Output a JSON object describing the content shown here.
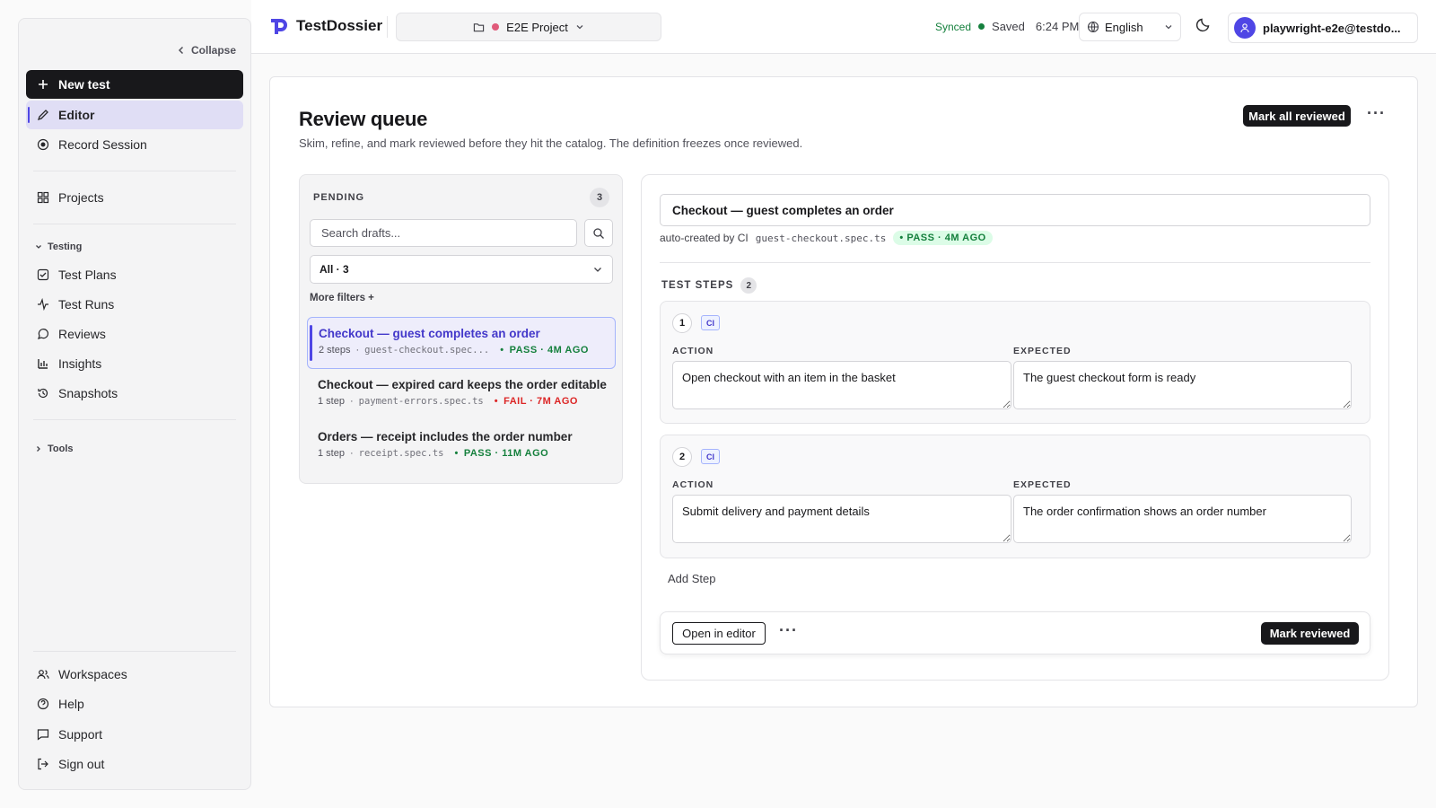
{
  "sidebar": {
    "collapse_label": "Collapse",
    "new_test": "New test",
    "items_top": [
      "Editor",
      "Record Session"
    ],
    "projects": "Projects",
    "testing_section": "Testing",
    "testing_items": [
      "Test Plans",
      "Test Runs",
      "Reviews",
      "Insights",
      "Snapshots"
    ],
    "tools_section": "Tools",
    "bottom_items": [
      "Workspaces",
      "Help",
      "Support",
      "Sign out"
    ]
  },
  "topbar": {
    "app_name": "TestDossier",
    "project_name": "E2E Project",
    "project_color": "#e05a7a",
    "sync_status": "Synced",
    "sync_color": "#15803d",
    "save_status": "Saved",
    "save_time": "6:24 PM",
    "language": "English",
    "user_email": "playwright-e2e@testdo..."
  },
  "page": {
    "title": "Review queue",
    "subtitle": "Skim, refine, and mark reviewed before they hit the catalog. The definition freezes once reviewed.",
    "mark_all_label": "Mark all reviewed",
    "more_icon": "ellipsis-icon"
  },
  "pending": {
    "title": "PENDING",
    "count": "3",
    "search_placeholder": "Search drafts...",
    "filter_value": "All · 3",
    "more_filters": "More filters +",
    "drafts": [
      {
        "title": "Checkout — guest completes an order",
        "steps": "2 steps",
        "file": "guest-checkout.spec...",
        "status": "PASS · 4M AGO",
        "result": "pass"
      },
      {
        "title": "Checkout — expired card keeps the order editable",
        "steps": "1 step",
        "file": "payment-errors.spec.ts",
        "status": "FAIL · 7M AGO",
        "result": "fail"
      },
      {
        "title": "Orders — receipt includes the order number",
        "steps": "1 step",
        "file": "receipt.spec.ts",
        "status": "PASS · 11M AGO",
        "result": "pass"
      }
    ]
  },
  "detail": {
    "title": "Checkout — guest completes an order",
    "origin": "auto-created by CI",
    "file": "guest-checkout.spec.ts",
    "status": "PASS · 4M AGO",
    "steps_label": "TEST STEPS",
    "steps_count": "2",
    "action_label": "ACTION",
    "expected_label": "EXPECTED",
    "ci_label": "CI",
    "steps": [
      {
        "num": "1",
        "action": "Open checkout with an item in the basket",
        "expected": "The guest checkout form is ready"
      },
      {
        "num": "2",
        "action": "Submit delivery and payment details",
        "expected": "The order confirmation shows an order number"
      }
    ],
    "add_step": "Add Step",
    "open_editor": "Open in editor",
    "mark_reviewed": "Mark reviewed"
  }
}
